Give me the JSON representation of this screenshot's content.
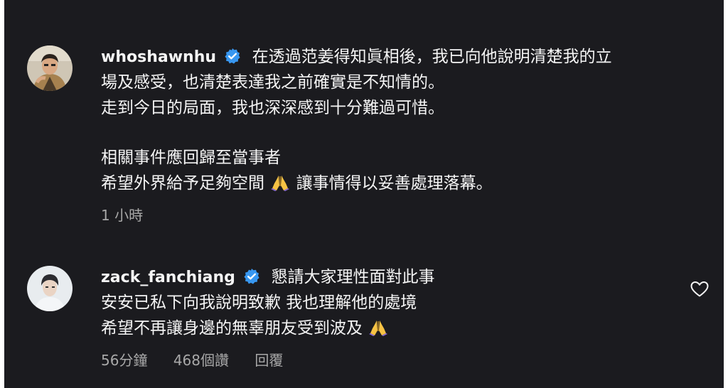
{
  "comments": [
    {
      "username": "whoshawnhu",
      "verified": true,
      "line1": "在透過范姜得知眞相後，我已向他說明清楚我的立",
      "line2": "場及感受，也清楚表達我之前確實是不知情的。",
      "line3": "走到今日的局面，我也深深感到十分難過可惜。",
      "line4": "相關事件應回歸至當事者",
      "line5_before": "希望外界給予足夠空間",
      "line5_emoji": "folded-hands-icon",
      "line5_after": "讓事情得以妥善處理落幕。",
      "time": "1 小時"
    },
    {
      "username": "zack_fanchiang",
      "verified": true,
      "line1": "懇請大家理性面對此事",
      "line2": "安安已私下向我說明致歉 我也理解他的處境",
      "line3_before": "希望不再讓身邊的無辜朋友受到波及",
      "line3_emoji": "folded-hands-icon",
      "time": "56分鐘",
      "likes": "468個讚",
      "reply": "回覆"
    }
  ],
  "colors": {
    "background": "#1b1b1f",
    "text": "#f5f5f5",
    "meta": "#a8a8a8",
    "verified": "#3897f0"
  }
}
